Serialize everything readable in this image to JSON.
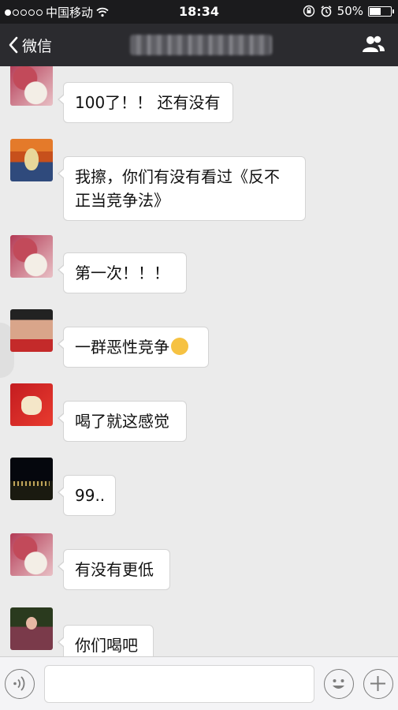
{
  "status_bar": {
    "carrier": "中国移动",
    "time": "18:34",
    "battery_percent": "50%",
    "battery_level": 0.5,
    "icons": [
      "signal-dots-icon",
      "wifi-icon",
      "orientation-lock-icon",
      "alarm-icon",
      "battery-icon"
    ]
  },
  "nav": {
    "back_label": "微信",
    "title_blurred": true,
    "right_icon": "group-members-icon"
  },
  "messages": [
    {
      "avatar": "pink-dog-avatar",
      "text": "100了！！ 还有没有"
    },
    {
      "avatar": "scream-painting-avatar",
      "text": "我擦，你们有没有看过《反不正当竞争法》"
    },
    {
      "avatar": "pink-dog-avatar",
      "text": "第一次！！！"
    },
    {
      "avatar": "man-portrait-avatar",
      "text": "一群恶性竞争",
      "emoji": "pensive-face-emoji"
    },
    {
      "avatar": "red-card-avatar",
      "text": "喝了就这感觉"
    },
    {
      "avatar": "night-city-avatar",
      "text": "99.."
    },
    {
      "avatar": "pink-dog-avatar",
      "text": "有没有更低"
    },
    {
      "avatar": "girl-photo-avatar",
      "text": "你们喝吧"
    }
  ],
  "input_bar": {
    "icons": [
      "voice-icon",
      "emoji-icon",
      "plus-icon"
    ],
    "input_value": ""
  }
}
